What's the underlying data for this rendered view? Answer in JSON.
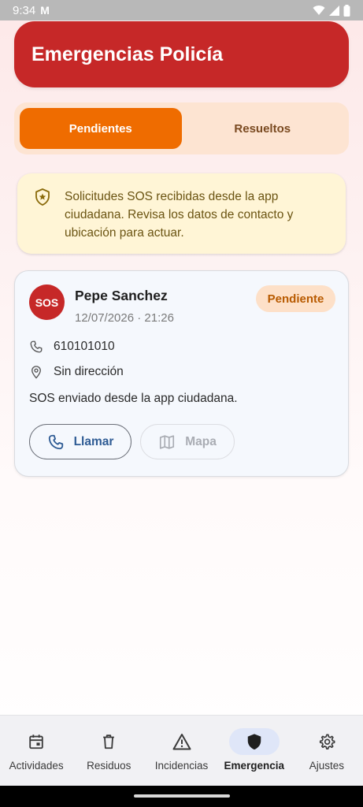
{
  "status_bar": {
    "time": "9:34",
    "mail_glyph": "M"
  },
  "header": {
    "title": "Emergencias Policía"
  },
  "tabs": [
    {
      "label": "Pendientes",
      "active": true
    },
    {
      "label": "Resueltos",
      "active": false
    }
  ],
  "info": {
    "icon": "shield-star-icon",
    "text": "Solicitudes SOS recibidas desde la app ciudadana. Revisa los datos de contacto y ubicación para actuar."
  },
  "request": {
    "avatar_text": "SOS",
    "name": "Pepe Sanchez",
    "datetime": "12/07/2026 · 21:26",
    "status": "Pendiente",
    "phone": "610101010",
    "address": "Sin dirección",
    "message": "SOS enviado desde la app ciudadana.",
    "call_label": "Llamar",
    "map_label": "Mapa"
  },
  "nav": [
    {
      "label": "Actividades",
      "icon": "calendar-icon",
      "active": false
    },
    {
      "label": "Residuos",
      "icon": "trash-icon",
      "active": false
    },
    {
      "label": "Incidencias",
      "icon": "warning-icon",
      "active": false
    },
    {
      "label": "Emergencia",
      "icon": "shield-icon",
      "active": true
    },
    {
      "label": "Ajustes",
      "icon": "gear-icon",
      "active": false
    }
  ],
  "colors": {
    "header": "#c62828",
    "tab_active": "#ef6c00",
    "info_bg": "#fff5d6",
    "badge_bg": "#fde0c8",
    "badge_text": "#b85a00",
    "call_text": "#2e5b94"
  }
}
